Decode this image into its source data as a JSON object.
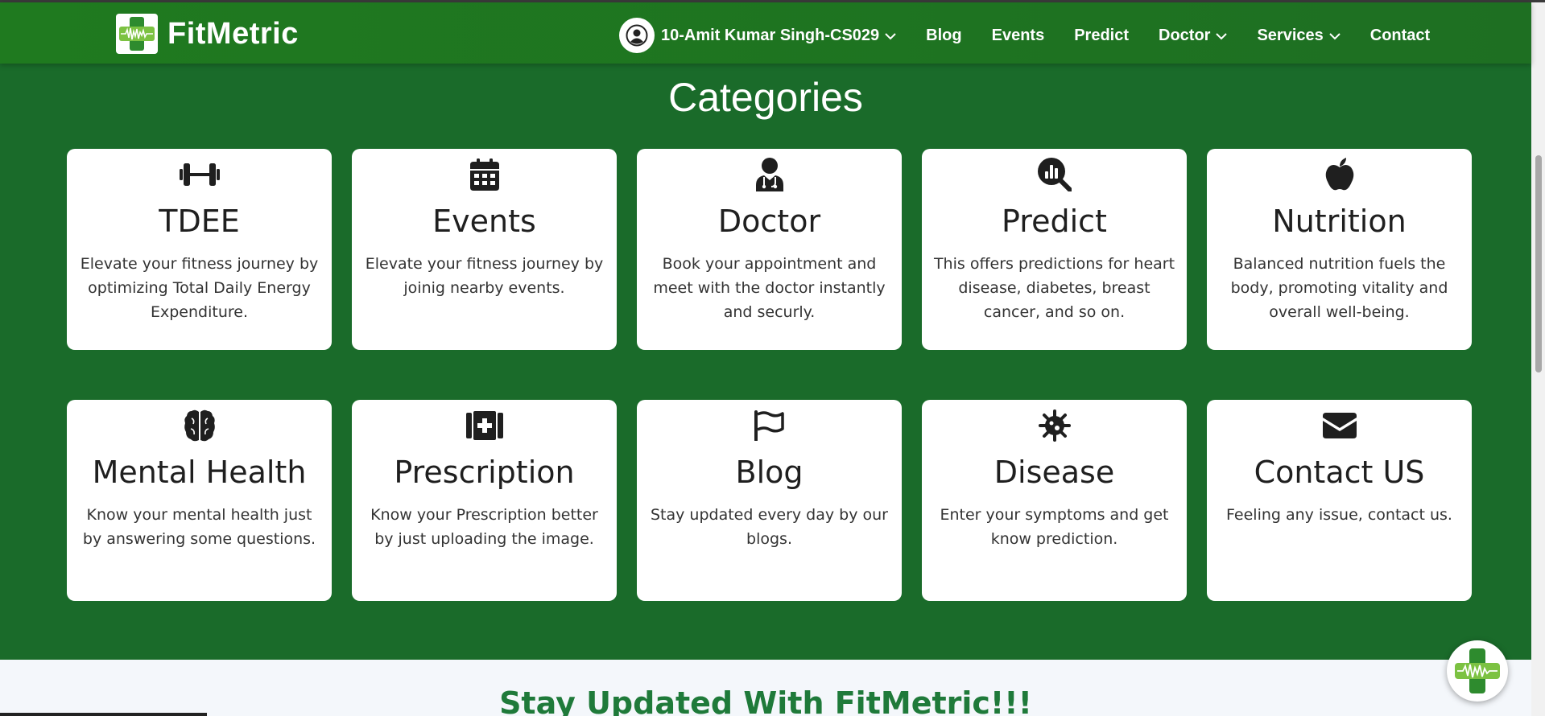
{
  "brand": {
    "name": "FitMetric",
    "logo_icon": "health-cross-heartbeat-icon"
  },
  "nav": {
    "user": "10-Amit Kumar Singh-CS029",
    "items": [
      {
        "label": "Blog"
      },
      {
        "label": "Events"
      },
      {
        "label": "Predict"
      },
      {
        "label": "Doctor"
      },
      {
        "label": "Services"
      },
      {
        "label": "Contact"
      }
    ]
  },
  "section": {
    "title": "Categories"
  },
  "cards": [
    {
      "icon": "dumbbell-icon",
      "title": "TDEE",
      "desc": "Elevate your fitness journey by optimizing Total Daily Energy Expenditure."
    },
    {
      "icon": "calendar-icon",
      "title": "Events",
      "desc": "Elevate your fitness journey by joinig nearby events."
    },
    {
      "icon": "doctor-icon",
      "title": "Doctor",
      "desc": "Book your appointment and meet with the doctor instantly and securly."
    },
    {
      "icon": "magnifier-chart-icon",
      "title": "Predict",
      "desc": "This offers predictions for heart disease, diabetes, breast cancer, and so on."
    },
    {
      "icon": "apple-icon",
      "title": "Nutrition",
      "desc": "Balanced nutrition fuels the body, promoting vitality and overall well-being."
    },
    {
      "icon": "brain-icon",
      "title": "Mental Health",
      "desc": "Know your mental health just by answering some questions."
    },
    {
      "icon": "medical-kit-icon",
      "title": "Prescription",
      "desc": "Know your Prescription better by just uploading the image."
    },
    {
      "icon": "flag-icon",
      "title": "Blog",
      "desc": "Stay updated every day by our blogs."
    },
    {
      "icon": "virus-icon",
      "title": "Disease",
      "desc": "Enter your symptoms and get know prediction."
    },
    {
      "icon": "envelope-icon",
      "title": "Contact US",
      "desc": "Feeling any issue, contact us."
    }
  ],
  "lower": {
    "title": "Stay Updated With FitMetric!!!"
  },
  "colors": {
    "background": "#1a6b2a",
    "navbar": "#1f7a1f",
    "card": "#ffffff",
    "accent": "#7cc242"
  }
}
